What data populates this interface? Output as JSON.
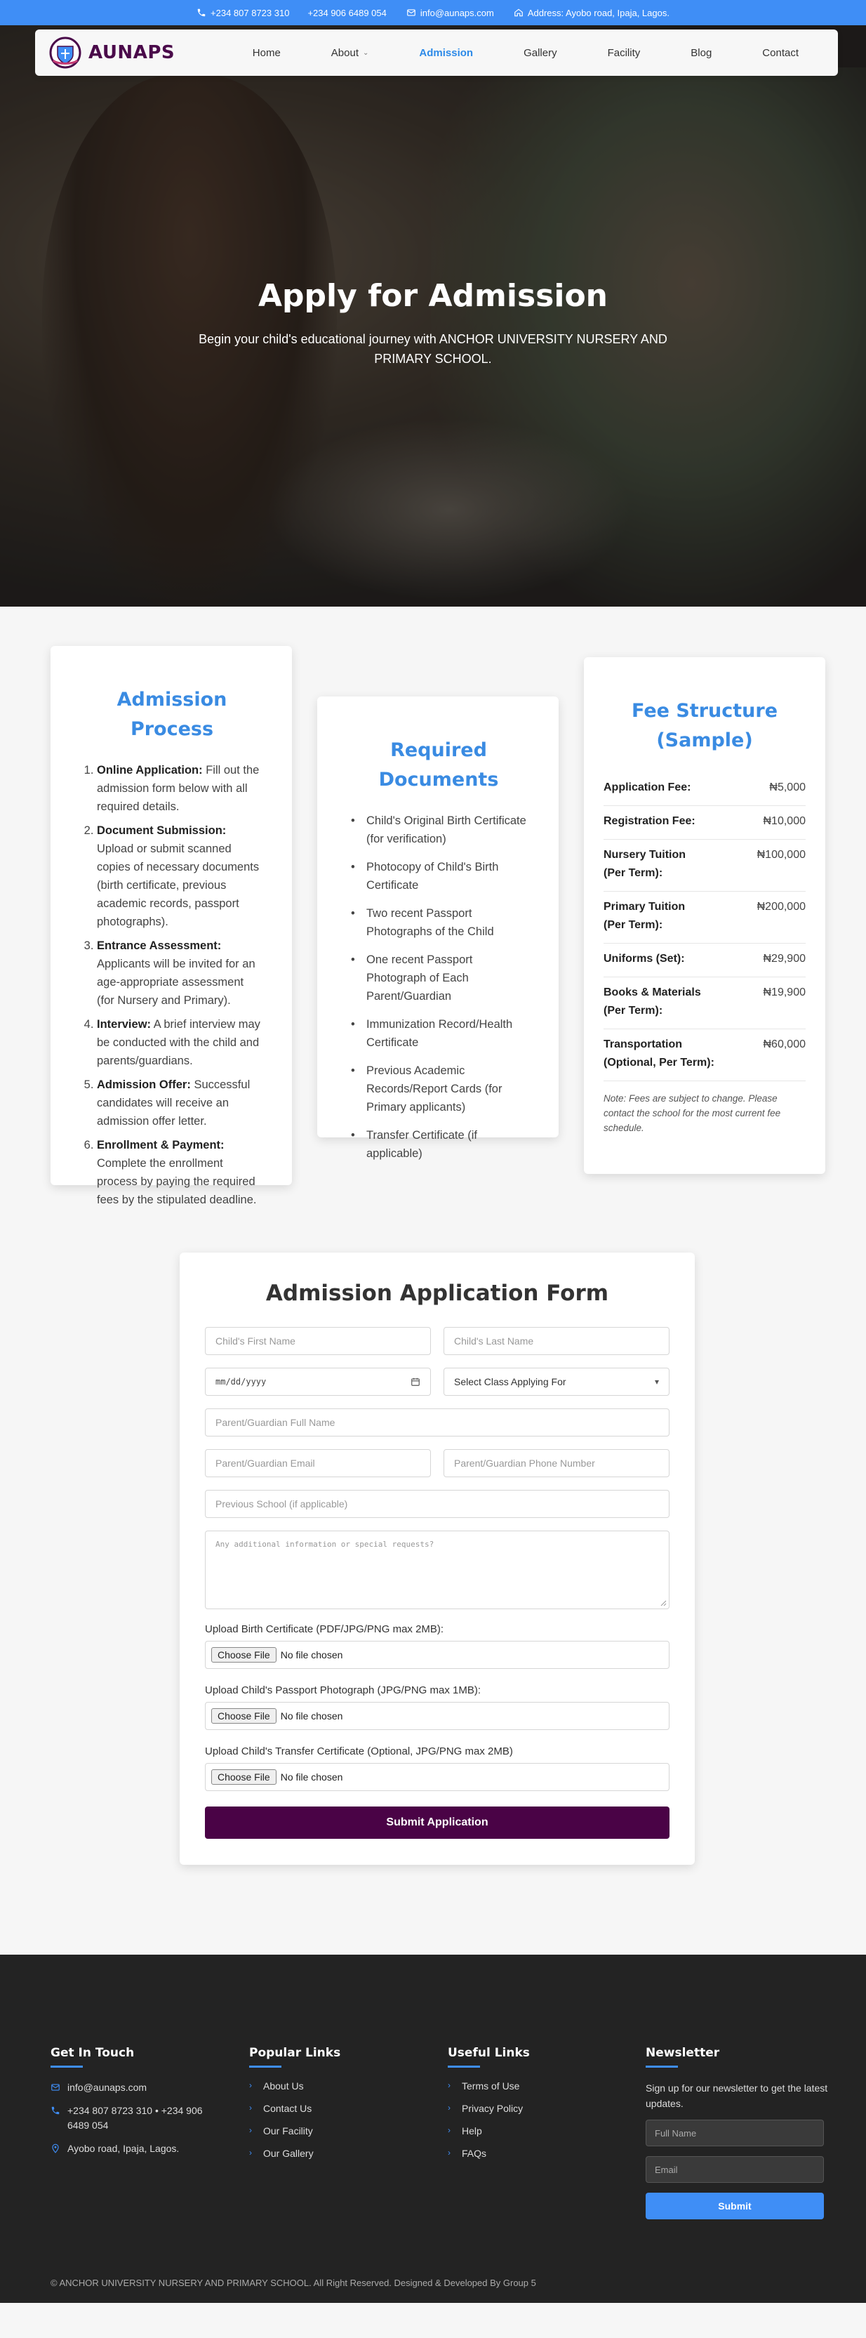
{
  "topbar": {
    "phone": "+234 807 8723 310",
    "phone2": "+234 906 6489 054",
    "email": "info@aunaps.com",
    "address": "Address: Ayobo road, Ipaja, Lagos."
  },
  "brand": {
    "name": "AUNAPS"
  },
  "nav": {
    "items": [
      {
        "label": "Home"
      },
      {
        "label": "About"
      },
      {
        "label": "Admission"
      },
      {
        "label": "Gallery"
      },
      {
        "label": "Facility"
      },
      {
        "label": "Blog"
      },
      {
        "label": "Contact"
      }
    ],
    "active_color": "#2d8ae8"
  },
  "hero": {
    "title": "Apply for Admission",
    "subtitle": "Begin your child's educational journey with ANCHOR UNIVERSITY NURSERY AND PRIMARY SCHOOL."
  },
  "process": {
    "title": "Admission Process",
    "steps": [
      {
        "title": "Online Application:",
        "text": " Fill out the admission form below with all required details."
      },
      {
        "title": "Document Submission:",
        "text": " Upload or submit scanned copies of necessary documents (birth certificate, previous academic records, passport photographs)."
      },
      {
        "title": "Entrance Assessment:",
        "text": " Applicants will be invited for an age-appropriate assessment (for Nursery and Primary)."
      },
      {
        "title": "Interview:",
        "text": " A brief interview may be conducted with the child and parents/guardians."
      },
      {
        "title": "Admission Offer:",
        "text": " Successful candidates will receive an admission offer letter."
      },
      {
        "title": "Enrollment & Payment:",
        "text": " Complete the enrollment process by paying the required fees by the stipulated deadline."
      }
    ]
  },
  "documents": {
    "title": "Required Documents",
    "items": [
      "Child's Original Birth Certificate (for verification)",
      "Photocopy of Child's Birth Certificate",
      "Two recent Passport Photographs of the Child",
      "One recent Passport Photograph of Each Parent/Guardian",
      "Immunization Record/Health Certificate",
      "Previous Academic Records/Report Cards (for Primary applicants)",
      "Transfer Certificate (if applicable)"
    ]
  },
  "fees": {
    "title": "Fee Structure (Sample)",
    "rows": [
      {
        "label": "Application Fee:",
        "value": "₦5,000"
      },
      {
        "label": "Registration Fee:",
        "value": "₦10,000"
      },
      {
        "label": "Nursery Tuition (Per Term):",
        "value": "₦100,000"
      },
      {
        "label": "Primary Tuition (Per Term):",
        "value": "₦200,000"
      },
      {
        "label": "Uniforms (Set):",
        "value": "₦29,900"
      },
      {
        "label": "Books & Materials (Per Term):",
        "value": "₦19,900"
      },
      {
        "label": "Transportation (Optional, Per Term):",
        "value": "₦60,000"
      }
    ],
    "note": "Note: Fees are subject to change. Please contact the school for the most current fee schedule."
  },
  "form": {
    "title": "Admission Application Form",
    "first_name_ph": "Child's First Name",
    "last_name_ph": "Child's Last Name",
    "dob_ph": "mm/dd/yyyy",
    "class_select": "Select Class Applying For",
    "guardian_name_ph": "Parent/Guardian Full Name",
    "guardian_email_ph": "Parent/Guardian Email",
    "guardian_phone_ph": "Parent/Guardian Phone Number",
    "prev_school_ph": "Previous School (if applicable)",
    "notes_ph": "Any additional information or special requests?",
    "uploads": [
      {
        "label": "Upload Birth Certificate (PDF/JPG/PNG max 2MB):"
      },
      {
        "label": "Upload Child's Passport Photograph (JPG/PNG max 1MB):"
      },
      {
        "label": "Upload Child's Transfer Certificate (Optional, JPG/PNG max 2MB)"
      }
    ],
    "choose_file": "Choose File",
    "no_file": "No file chosen",
    "submit": "Submit Application"
  },
  "footer": {
    "touch_title": "Get In Touch",
    "email": "info@aunaps.com",
    "phones": "+234 807 8723 310 • +234 906 6489 054",
    "address": "Ayobo road, Ipaja, Lagos.",
    "popular_title": "Popular Links",
    "popular": [
      "About Us",
      "Contact Us",
      "Our Facility",
      "Our Gallery"
    ],
    "useful_title": "Useful Links",
    "useful": [
      "Terms of Use",
      "Privacy Policy",
      "Help",
      "FAQs"
    ],
    "newsletter_title": "Newsletter",
    "newsletter_text": "Sign up for our newsletter to get the latest updates.",
    "nl_name_ph": "Full Name",
    "nl_email_ph": "Email",
    "nl_submit": "Submit",
    "copyright": "© ANCHOR UNIVERSITY NURSERY AND PRIMARY SCHOOL. All Right Reserved. Designed & Developed By Group 5"
  },
  "colors": {
    "accent_blue": "#3f8ef6",
    "heading_blue": "#3a8be2",
    "brand_purple": "#4a0346",
    "footer_bg": "#232323"
  },
  "icons": [
    "phone-icon",
    "mail-icon",
    "home-icon",
    "location-icon",
    "calendar-icon",
    "chevron-down-icon",
    "chevron-right-icon"
  ]
}
